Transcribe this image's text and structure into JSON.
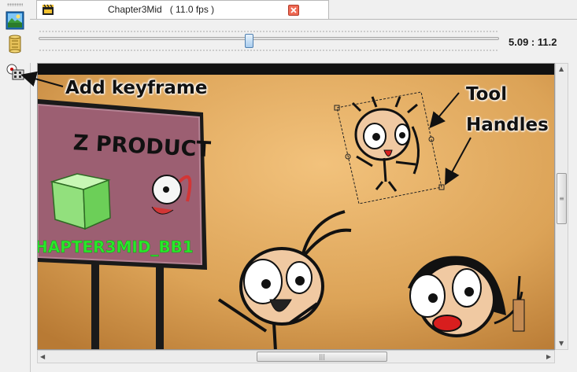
{
  "left_toolbar": {
    "buttons": [
      {
        "icon": "image-icon"
      },
      {
        "icon": "script-scroll-icon"
      },
      {
        "icon": "add-keyframe-icon"
      }
    ]
  },
  "tab": {
    "title": "Chapter3Mid   ( 11.0 fps )",
    "close_icon": "close-icon"
  },
  "timeline": {
    "readout": "5.09 : 11.2",
    "position_fraction": 0.454
  },
  "scene": {
    "billboard_text": "Z PRODUCT",
    "object_label": "HAPTER3MID_BB1",
    "colors": {
      "background": "#d79a48",
      "billboard": "#9c5f72",
      "label": "#29e82a"
    }
  },
  "annotations": {
    "add_keyframe": "Add keyframe",
    "tool": "Tool",
    "handles": "Handles"
  },
  "scrollbars": {
    "v_thumb_grip": "≡",
    "h_thumb_grip": "|||"
  }
}
